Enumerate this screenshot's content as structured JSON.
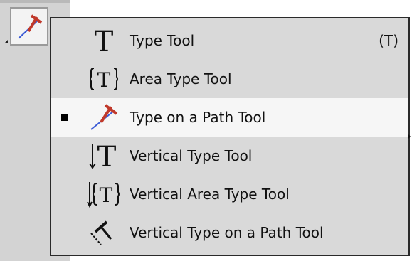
{
  "toolbar": {
    "active_tool_icon": "type-on-a-path-icon"
  },
  "menu": {
    "items": [
      {
        "label": "Type Tool",
        "shortcut": "(T)",
        "icon": "type-tool-icon",
        "selected": false
      },
      {
        "label": "Area Type Tool",
        "shortcut": "",
        "icon": "area-type-tool-icon",
        "selected": false
      },
      {
        "label": "Type on a Path Tool",
        "shortcut": "",
        "icon": "type-on-a-path-icon",
        "selected": true
      },
      {
        "label": "Vertical Type Tool",
        "shortcut": "",
        "icon": "vertical-type-tool-icon",
        "selected": false
      },
      {
        "label": "Vertical Area Type Tool",
        "shortcut": "",
        "icon": "vertical-area-type-tool-icon",
        "selected": false
      },
      {
        "label": "Vertical Type on a Path Tool",
        "shortcut": "",
        "icon": "vertical-type-on-a-path-icon",
        "selected": false
      }
    ]
  },
  "colors": {
    "path_icon_red": "#c0392b",
    "path_icon_blue": "#3b5bd6",
    "selected_row": "#f6f6f6",
    "menu_background": "#d9d9d9"
  }
}
